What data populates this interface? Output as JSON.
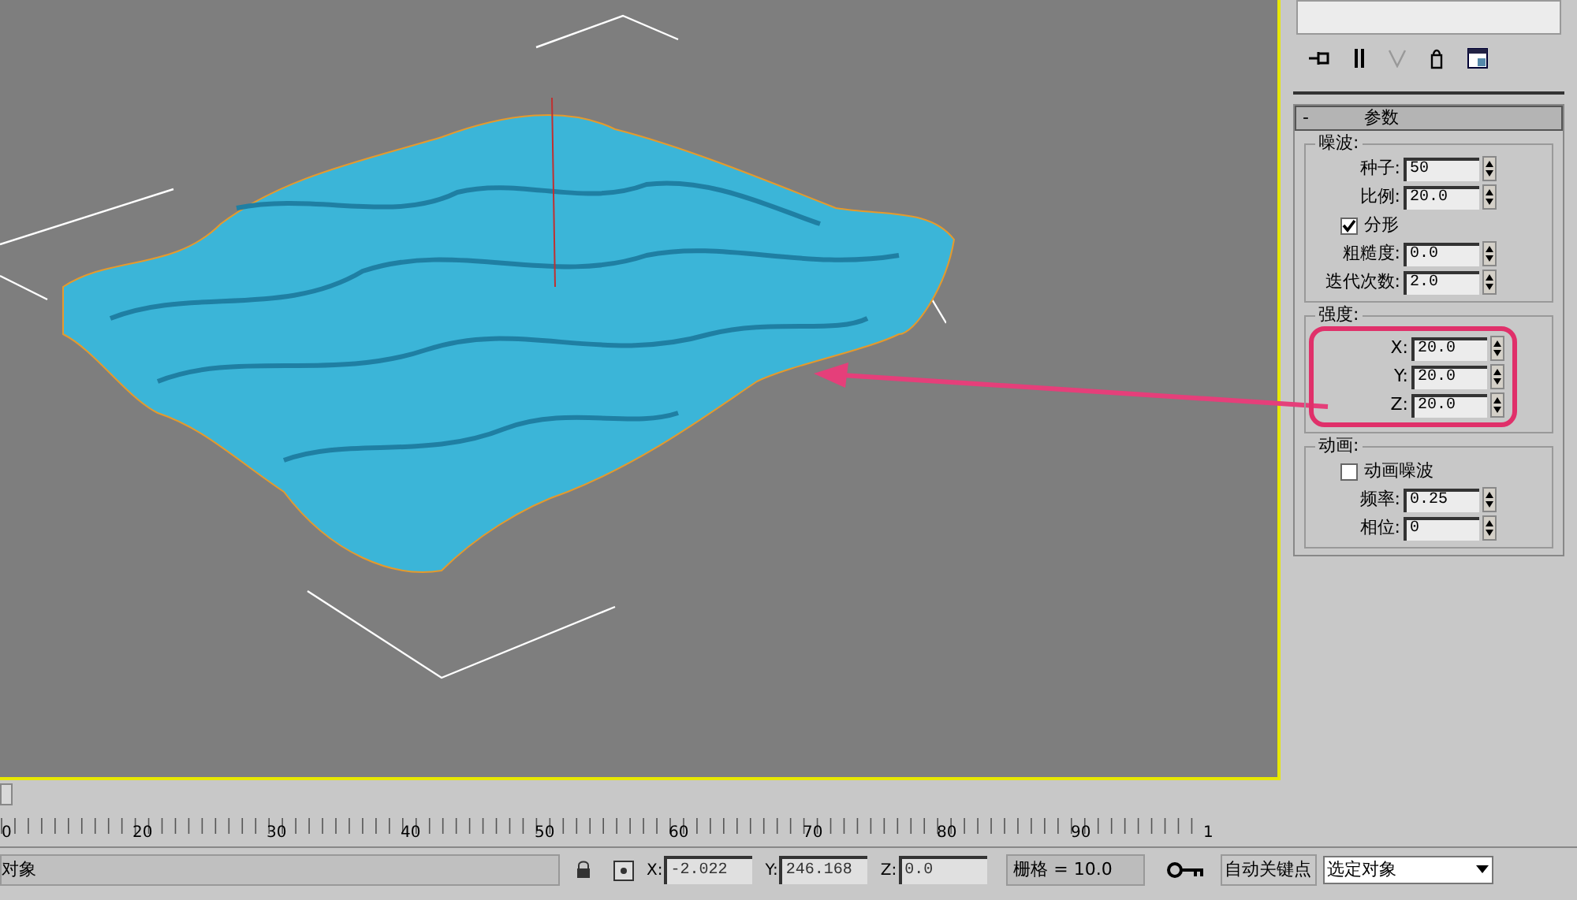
{
  "command_panel": {
    "rollout": {
      "sign": "-",
      "title": "参数"
    },
    "groups": [
      {
        "title": "噪波:",
        "rows": [
          {
            "kind": "spinner",
            "label": "种子:",
            "value": "50"
          },
          {
            "kind": "spinner",
            "label": "比例:",
            "value": "20.0"
          },
          {
            "kind": "checkbox",
            "label": "分形",
            "checked": true
          },
          {
            "kind": "spinner",
            "label": "粗糙度:",
            "value": "0.0"
          },
          {
            "kind": "spinner",
            "label": "迭代次数:",
            "value": "2.0"
          }
        ]
      },
      {
        "title": "强度:",
        "highlighted": true,
        "rows": [
          {
            "kind": "spinner",
            "label": "X:",
            "value": "20.0"
          },
          {
            "kind": "spinner",
            "label": "Y:",
            "value": "20.0"
          },
          {
            "kind": "spinner",
            "label": "Z:",
            "value": "20.0"
          }
        ]
      },
      {
        "title": "动画:",
        "rows": [
          {
            "kind": "checkbox",
            "label": "动画噪波",
            "checked": false
          },
          {
            "kind": "spinner",
            "label": "频率:",
            "value": "0.25"
          },
          {
            "kind": "spinner",
            "label": "相位:",
            "value": "0"
          }
        ]
      }
    ]
  },
  "timeline": {
    "level": 0,
    "ticks": [
      "0",
      "20",
      "30",
      "40",
      "50",
      "60",
      "70",
      "80",
      "90",
      "1"
    ]
  },
  "status_bar": {
    "prompt": "对象",
    "x": {
      "label": "X:",
      "value": "-2.022"
    },
    "y": {
      "label": "Y:",
      "value": "246.168"
    },
    "z": {
      "label": "Z:",
      "value": "0.0"
    },
    "grid": "栅格 = 10.0",
    "auto_key": "自动关键点",
    "selection": "选定对象"
  }
}
